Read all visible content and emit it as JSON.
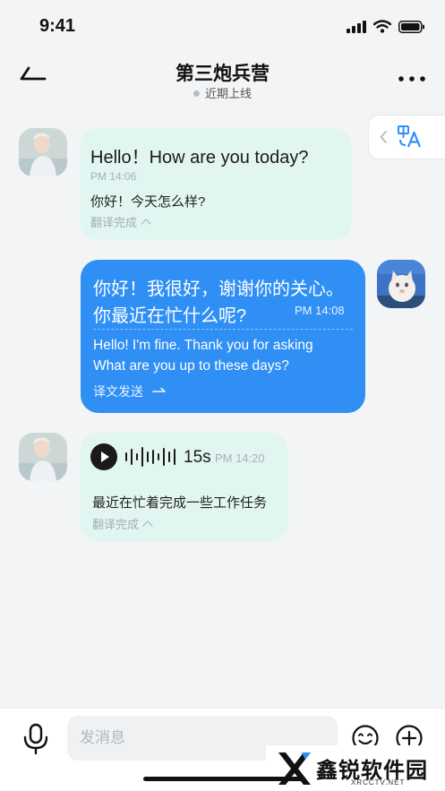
{
  "status_bar": {
    "time": "9:41"
  },
  "header": {
    "title": "第三炮兵营",
    "presence": "近期上线"
  },
  "translate_toggle": {
    "icon": "translate-icon"
  },
  "messages": [
    {
      "direction": "incoming",
      "text": "Hello！How are you today?",
      "time": "PM 14:06",
      "translation": "你好！今天怎么样?",
      "status": "翻译完成"
    },
    {
      "direction": "outgoing",
      "text_line1": "你好！我很好，谢谢你的关心。",
      "text_line2": "你最近在忙什么呢?",
      "time": "PM 14:08",
      "translation_line1": "Hello! I'm fine. Thank you for asking",
      "translation_line2": "What are you up to these days?",
      "status": "译文发送"
    },
    {
      "direction": "incoming",
      "type": "voice",
      "duration": "15s",
      "time": "PM 14:20",
      "translation": "最近在忙着完成一些工作任务",
      "status": "翻译完成"
    }
  ],
  "input_bar": {
    "placeholder": "发消息"
  },
  "watermark": {
    "brand": "鑫锐软件园",
    "domain": "XRCCTV.NET"
  },
  "colors": {
    "incoming_bubble": "#e2f6f1",
    "outgoing_bubble": "#2f8ff5",
    "accent": "#2f8ff5"
  }
}
